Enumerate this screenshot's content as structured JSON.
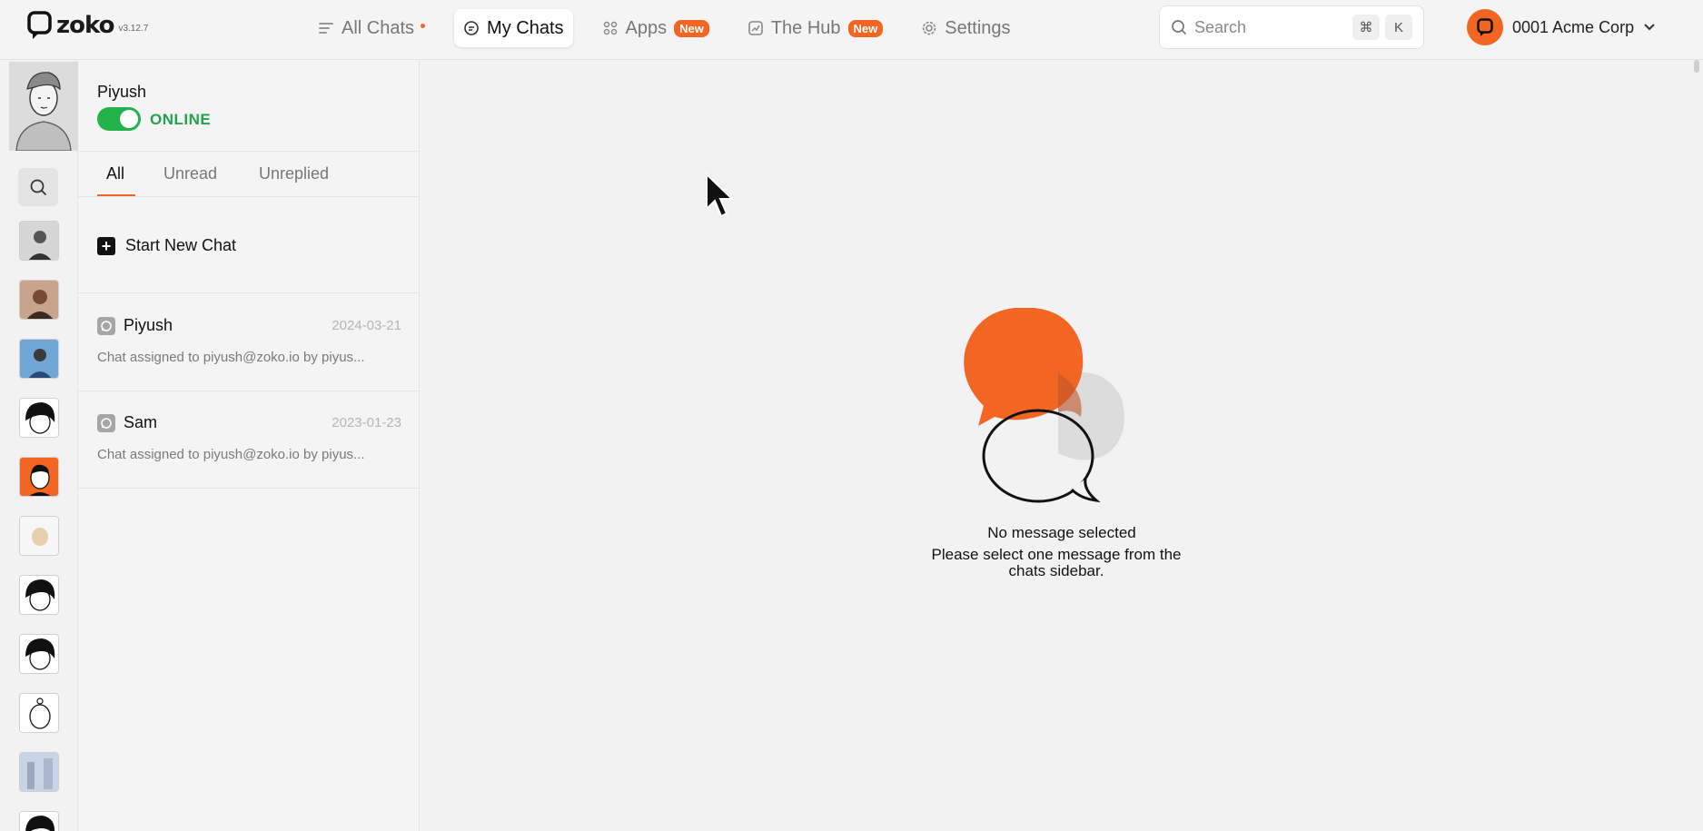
{
  "brand": {
    "name": "zoko",
    "version": "v3.12.7"
  },
  "nav": [
    {
      "label": "All Chats",
      "active": false,
      "dot": true,
      "badge": ""
    },
    {
      "label": "My Chats",
      "active": true,
      "dot": false,
      "badge": ""
    },
    {
      "label": "Apps",
      "active": false,
      "dot": false,
      "badge": "New"
    },
    {
      "label": "The Hub",
      "active": false,
      "dot": false,
      "badge": "New"
    },
    {
      "label": "Settings",
      "active": false,
      "dot": false,
      "badge": ""
    }
  ],
  "search": {
    "placeholder": "Search",
    "shortcut_keys": [
      "⌘",
      "K"
    ]
  },
  "account": {
    "name": "0001 Acme Corp"
  },
  "profile": {
    "name": "Piyush",
    "status": "ONLINE",
    "online": true
  },
  "tabs": [
    "All",
    "Unread",
    "Unreplied"
  ],
  "new_chat_label": "Start New Chat",
  "chats": [
    {
      "name": "Piyush",
      "date": "2024-03-21",
      "preview": "Chat assigned to piyush@zoko.io by piyus..."
    },
    {
      "name": "Sam",
      "date": "2023-01-23",
      "preview": "Chat assigned to piyush@zoko.io by piyus..."
    }
  ],
  "empty_state": {
    "title": "No message selected",
    "description": "Please select one message from the chats sidebar."
  },
  "colors": {
    "accent": "#f26522",
    "online": "#22b24c"
  },
  "icons": [
    "zoko-logo-icon",
    "list-icon",
    "chat-icon",
    "apps-icon",
    "hub-icon",
    "gear-icon",
    "search-icon",
    "chevron-down-icon",
    "plus-icon",
    "whatsapp-icon"
  ]
}
